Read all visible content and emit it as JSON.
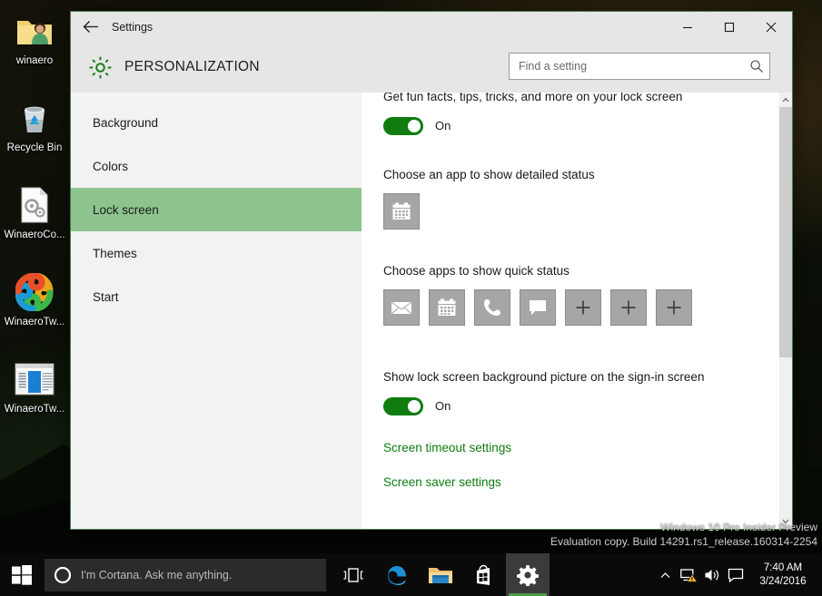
{
  "desktop": {
    "icons": [
      {
        "label": "winaero",
        "icon": "user-folder-icon"
      },
      {
        "label": "Recycle Bin",
        "icon": "recycle-bin-icon"
      },
      {
        "label": "WinaeroCo...",
        "icon": "config-file-icon"
      },
      {
        "label": "WinaeroTw...",
        "icon": "winaero-tweaker-icon"
      },
      {
        "label": "WinaeroTw...",
        "icon": "winaero-window-icon"
      }
    ]
  },
  "window": {
    "titlebar_title": "Settings",
    "back_label": "Back",
    "minimize_label": "Minimize",
    "maximize_label": "Maximize",
    "close_label": "Close",
    "page_title": "PERSONALIZATION"
  },
  "search": {
    "placeholder": "Find a setting",
    "value": ""
  },
  "nav": {
    "items": [
      {
        "label": "Background",
        "selected": false
      },
      {
        "label": "Colors",
        "selected": false
      },
      {
        "label": "Lock screen",
        "selected": true
      },
      {
        "label": "Themes",
        "selected": false
      },
      {
        "label": "Start",
        "selected": false
      }
    ]
  },
  "content": {
    "fun_facts_label": "Get fun facts, tips, tricks, and more on your lock screen",
    "fun_facts_state": "On",
    "detailed_status_label": "Choose an app to show detailed status",
    "detailed_status_app": "calendar-icon",
    "quick_status_label": "Choose apps to show quick status",
    "quick_status_apps": [
      "mail-icon",
      "calendar-icon",
      "phone-icon",
      "message-icon",
      "plus-icon",
      "plus-icon",
      "plus-icon"
    ],
    "signin_picture_label": "Show lock screen background picture on the sign-in screen",
    "signin_picture_state": "On",
    "screen_timeout_link": "Screen timeout settings",
    "screen_saver_link": "Screen saver settings"
  },
  "watermark": {
    "line1": "Windows 10 Pro Insider Preview",
    "line2": "Evaluation copy. Build 14291.rs1_release.160314-2254"
  },
  "taskbar": {
    "start_label": "Start",
    "cortana_placeholder": "I'm Cortana. Ask me anything.",
    "taskview_label": "Task View",
    "apps": [
      {
        "name": "edge-icon",
        "active": false
      },
      {
        "name": "file-explorer-icon",
        "active": false
      },
      {
        "name": "store-icon",
        "active": false
      },
      {
        "name": "settings-gear-icon",
        "active": true
      }
    ],
    "tray": [
      "chevron-up-icon",
      "network-warning-icon",
      "volume-icon",
      "action-center-icon"
    ],
    "time": "7:40 AM",
    "date": "3/24/2016"
  },
  "colors": {
    "accent_green": "#107c10",
    "selection_green": "#8dc48d",
    "titlebar_gray": "#e6e6e6",
    "nav_gray": "#f2f2f2",
    "tile_gray": "#a6a6a6"
  }
}
